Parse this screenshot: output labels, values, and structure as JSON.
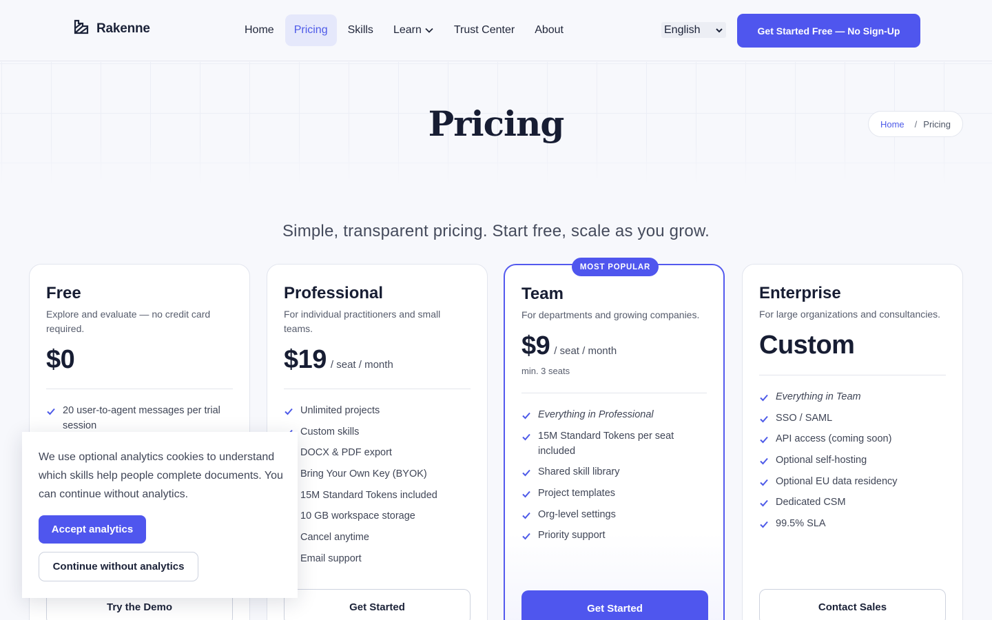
{
  "header": {
    "brand": "Rakenne",
    "nav": [
      {
        "label": "Home"
      },
      {
        "label": "Pricing",
        "active": true
      },
      {
        "label": "Skills"
      },
      {
        "label": "Learn",
        "dropdown": true
      },
      {
        "label": "Trust Center"
      },
      {
        "label": "About"
      }
    ],
    "language": "English",
    "cta": "Get Started Free — No Sign-Up"
  },
  "hero": {
    "title": "Pricing",
    "breadcrumb": {
      "home": "Home",
      "separator": "/",
      "current": "Pricing"
    }
  },
  "subtitle": "Simple, transparent pricing. Start free, scale as you grow.",
  "plans": [
    {
      "name": "Free",
      "description": "Explore and evaluate — no credit card required.",
      "price": "$0",
      "features": [
        "20 user-to-agent messages per trial session"
      ],
      "button": "Try the Demo"
    },
    {
      "name": "Professional",
      "description": "For individual practitioners and small teams.",
      "price": "$19",
      "per": "/ seat / month",
      "features": [
        "Unlimited projects",
        "Custom skills",
        "DOCX & PDF export",
        "Bring Your Own Key (BYOK)",
        "15M Standard Tokens included",
        "10 GB workspace storage",
        "Cancel anytime",
        "Email support"
      ],
      "button": "Get Started"
    },
    {
      "name": "Team",
      "badge": "MOST POPULAR",
      "description": "For departments and growing companies.",
      "price": "$9",
      "per": "/ seat / month",
      "note": "min. 3 seats",
      "features": [
        "Everything in Professional",
        "15M Standard Tokens per seat included",
        "Shared skill library",
        "Project templates",
        "Org-level settings",
        "Priority support"
      ],
      "button": "Get Started"
    },
    {
      "name": "Enterprise",
      "description": "For large organizations and consultancies.",
      "price": "Custom",
      "features": [
        "Everything in Team",
        "SSO / SAML",
        "API access (coming soon)",
        "Optional self-hosting",
        "Optional EU data residency",
        "Dedicated CSM",
        "99.5% SLA"
      ],
      "button": "Contact Sales"
    }
  ],
  "cookie": {
    "text": "We use optional analytics cookies to understand which skills help people complete documents. You can continue without analytics.",
    "accept": "Accept analytics",
    "decline": "Continue without analytics"
  },
  "colors": {
    "accent": "#4f56ee",
    "text": "#171d33",
    "muted": "#565c6c",
    "background": "#f7f8fc"
  }
}
